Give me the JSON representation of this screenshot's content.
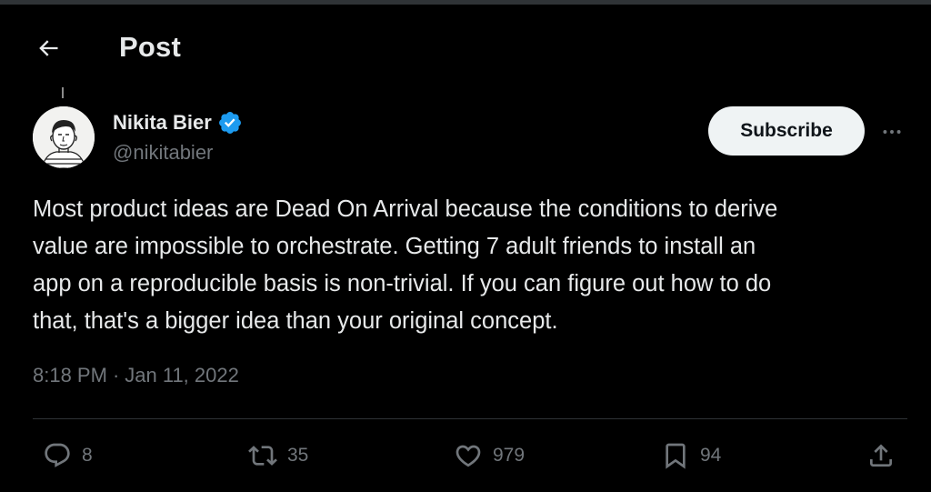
{
  "header": {
    "back_label": "←",
    "title": "Post"
  },
  "author": {
    "name": "Nikita Bier",
    "handle": "@nikitabier",
    "verified": true,
    "verified_color": "#1d9bf0"
  },
  "subscribe_label": "Subscribe",
  "tweet": {
    "text": "Most product ideas are Dead On Arrival because the conditions to derive\nvalue are impossible to orchestrate. Getting 7 adult friends to install an\napp on a reproducible basis is non-trivial. If you can figure out how to do\nthat, that's a bigger idea than your original concept.",
    "time": "8:18 PM",
    "separator": "·",
    "date": "Jan 11, 2022"
  },
  "actions": {
    "replies": "8",
    "reposts": "35",
    "likes": "979",
    "bookmarks": "94"
  },
  "icons": {
    "back": "arrow-left-icon",
    "verified": "verified-badge-icon",
    "more": "more-horizontal-icon",
    "reply": "reply-icon",
    "repost": "repost-icon",
    "like": "heart-icon",
    "bookmark": "bookmark-icon",
    "share": "share-icon"
  },
  "colors": {
    "background": "#000000",
    "text_primary": "#e7e9ea",
    "text_secondary": "#71767b",
    "divider": "#2f3336",
    "button_bg": "#eff3f4",
    "button_text": "#0f1419"
  }
}
